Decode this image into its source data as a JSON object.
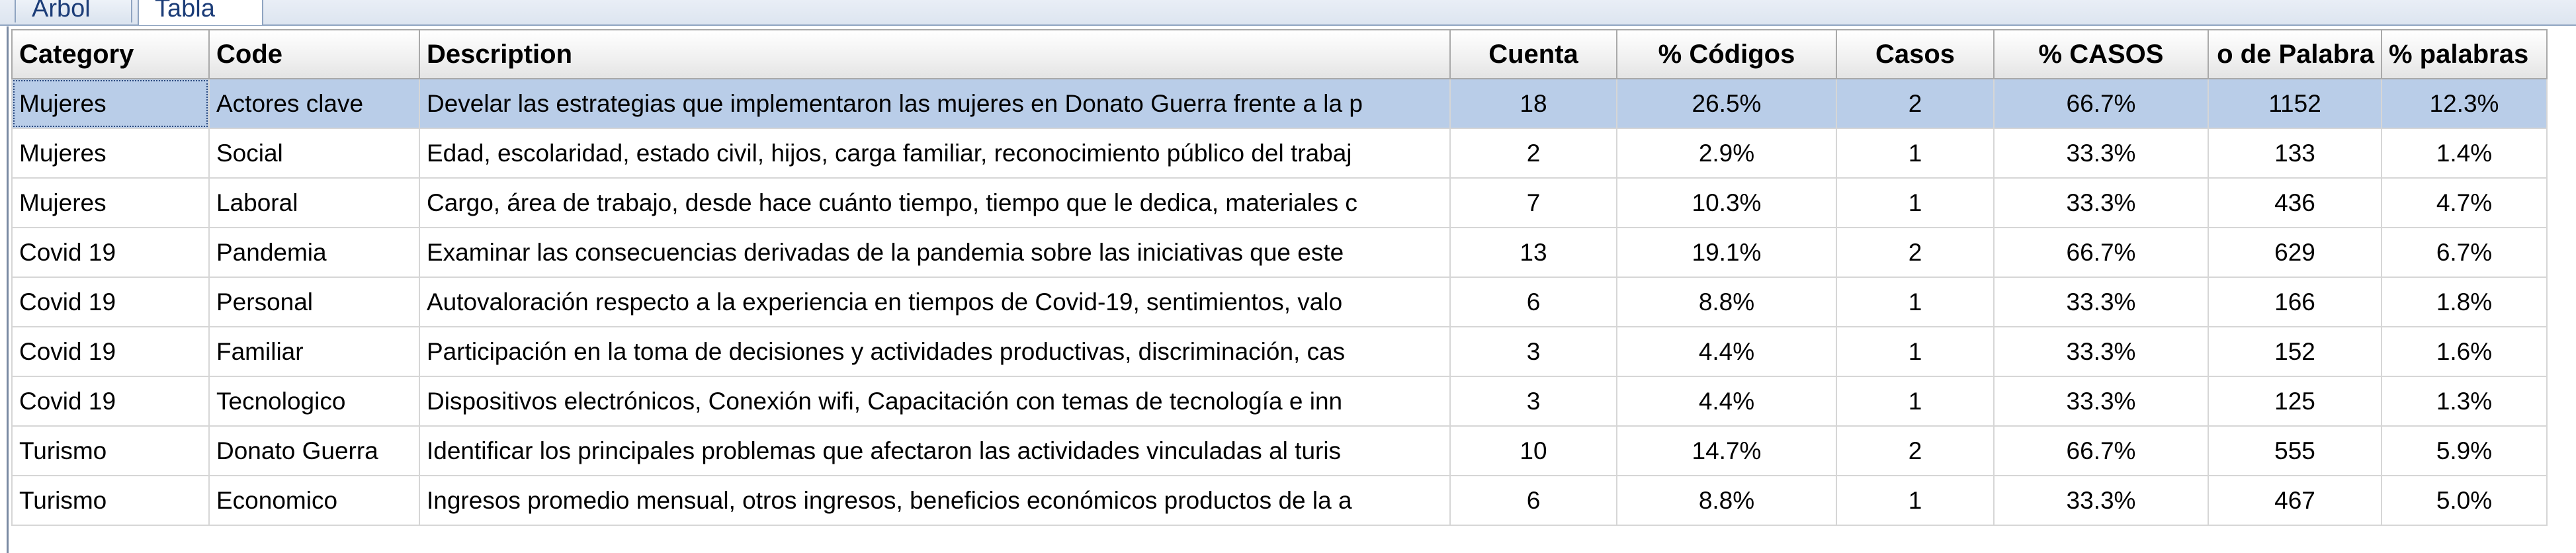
{
  "tabs": [
    {
      "label": "Arbol",
      "active": false
    },
    {
      "label": "Tabla",
      "active": true
    }
  ],
  "table": {
    "headers": [
      "Category",
      "Code",
      "Description",
      "Cuenta",
      "% Códigos",
      "Casos",
      "% CASOS",
      "o de Palabra",
      "% palabras"
    ],
    "selected_row": 0,
    "rows": [
      [
        "Mujeres",
        "Actores clave",
        "Develar las estrategias que implementaron las mujeres en Donato Guerra frente a la p",
        "18",
        "26.5%",
        "2",
        "66.7%",
        "1152",
        "12.3%"
      ],
      [
        "Mujeres",
        "Social",
        "Edad, escolaridad, estado civil, hijos, carga familiar, reconocimiento público del trabaj",
        "2",
        "2.9%",
        "1",
        "33.3%",
        "133",
        "1.4%"
      ],
      [
        "Mujeres",
        "Laboral",
        "Cargo, área de trabajo, desde hace cuánto tiempo, tiempo que le dedica, materiales c",
        "7",
        "10.3%",
        "1",
        "33.3%",
        "436",
        "4.7%"
      ],
      [
        "Covid 19",
        "Pandemia",
        "Examinar las consecuencias derivadas de la pandemia sobre las iniciativas que este",
        "13",
        "19.1%",
        "2",
        "66.7%",
        "629",
        "6.7%"
      ],
      [
        "Covid 19",
        "Personal",
        "Autovaloración respecto a la experiencia en tiempos de Covid-19, sentimientos, valo",
        "6",
        "8.8%",
        "1",
        "33.3%",
        "166",
        "1.8%"
      ],
      [
        "Covid 19",
        "Familiar",
        "Participación en la toma de decisiones y actividades productivas, discriminación, cas",
        "3",
        "4.4%",
        "1",
        "33.3%",
        "152",
        "1.6%"
      ],
      [
        "Covid 19",
        "Tecnologico",
        "Dispositivos electrónicos, Conexión wifi, Capacitación con temas de tecnología e inn",
        "3",
        "4.4%",
        "1",
        "33.3%",
        "125",
        "1.3%"
      ],
      [
        "Turismo",
        "Donato Guerra",
        "Identificar los principales problemas que afectaron las actividades vinculadas al turis",
        "10",
        "14.7%",
        "2",
        "66.7%",
        "555",
        "5.9%"
      ],
      [
        "Turismo",
        "Economico",
        "Ingresos promedio mensual, otros ingresos, beneficios económicos productos de la a",
        "6",
        "8.8%",
        "1",
        "33.3%",
        "467",
        "5.0%"
      ]
    ]
  }
}
